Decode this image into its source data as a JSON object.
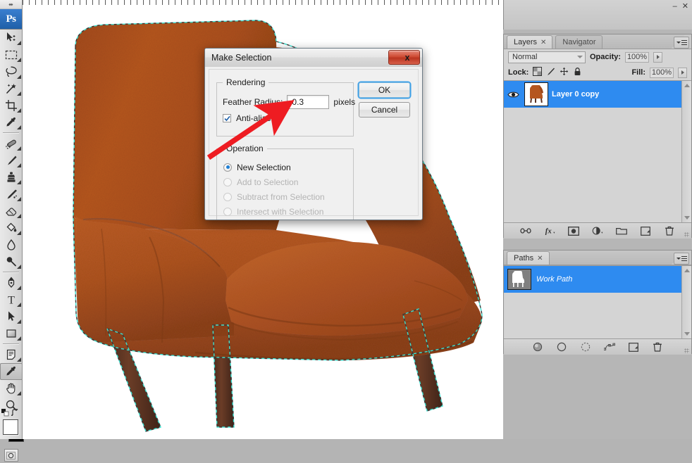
{
  "app": {
    "name": "Adobe Photoshop",
    "logo_text": "Ps"
  },
  "toolbar": {
    "grip_label": "⬌",
    "tools": [
      {
        "name": "move-tool",
        "title": "Move Tool"
      },
      {
        "name": "rectangular-marquee-tool",
        "title": "Rectangular Marquee Tool"
      },
      {
        "name": "lasso-tool",
        "title": "Lasso Tool"
      },
      {
        "name": "magic-wand-tool",
        "title": "Quick Selection / Magic Wand Tool"
      },
      {
        "name": "crop-tool",
        "title": "Crop Tool"
      },
      {
        "name": "eyedropper-tool",
        "title": "Eyedropper Tool"
      },
      {
        "name": "healing-brush-tool",
        "title": "Spot Healing Brush Tool"
      },
      {
        "name": "brush-tool",
        "title": "Brush Tool"
      },
      {
        "name": "clone-stamp-tool",
        "title": "Clone Stamp Tool"
      },
      {
        "name": "history-brush-tool",
        "title": "History Brush Tool"
      },
      {
        "name": "eraser-tool",
        "title": "Eraser Tool"
      },
      {
        "name": "paint-bucket-tool",
        "title": "Gradient / Paint Bucket Tool"
      },
      {
        "name": "blur-tool",
        "title": "Blur Tool"
      },
      {
        "name": "dodge-tool",
        "title": "Dodge Tool"
      },
      {
        "name": "pen-tool",
        "title": "Pen Tool"
      },
      {
        "name": "type-tool",
        "title": "Horizontal Type Tool"
      },
      {
        "name": "path-selection-tool",
        "title": "Path Selection Tool"
      },
      {
        "name": "rectangle-shape-tool",
        "title": "Rectangle Tool"
      },
      {
        "name": "notes-tool",
        "title": "Notes Tool"
      },
      {
        "name": "color-sampler-tool",
        "title": "Eyedropper Tool"
      },
      {
        "name": "hand-tool",
        "title": "Hand Tool"
      },
      {
        "name": "zoom-tool",
        "title": "Zoom Tool"
      }
    ],
    "foreground_color": "#ffffff",
    "background_color": "#000000",
    "quick_mask_label": "Edit in Quick Mask Mode"
  },
  "dialog": {
    "title": "Make Selection",
    "close_label": "x",
    "rendering": {
      "legend": "Rendering",
      "feather_label": "Feather Radius:",
      "feather_value": "0.3",
      "feather_units": "pixels",
      "antialiased_label": "Anti-aliased",
      "antialiased_checked": true
    },
    "operation": {
      "legend": "Operation",
      "options": [
        {
          "label": "New Selection",
          "selected": true,
          "disabled": false
        },
        {
          "label": "Add to Selection",
          "selected": false,
          "disabled": true
        },
        {
          "label": "Subtract from Selection",
          "selected": false,
          "disabled": true
        },
        {
          "label": "Intersect with Selection",
          "selected": false,
          "disabled": true
        }
      ]
    },
    "buttons": {
      "ok": "OK",
      "cancel": "Cancel"
    },
    "annotation": {
      "type": "red-arrow",
      "color": "#ee1c22",
      "points_to": "feather-radius-input"
    }
  },
  "dock": {
    "window_minimize": "–",
    "window_close": "✕"
  },
  "layers_panel": {
    "tabs": [
      {
        "label": "Layers",
        "active": true,
        "closable": true
      },
      {
        "label": "Navigator",
        "active": false,
        "closable": false
      }
    ],
    "blend_mode": "Normal",
    "opacity_label": "Opacity:",
    "opacity_value": "100%",
    "lock_label": "Lock:",
    "lock_icons": [
      "lock-transparent-pixels-icon",
      "lock-image-pixels-icon",
      "lock-position-icon",
      "lock-all-icon"
    ],
    "fill_label": "Fill:",
    "fill_value": "100%",
    "layers": [
      {
        "name": "Layer 0 copy",
        "visible": true,
        "selected": true
      }
    ],
    "footer_buttons": [
      {
        "name": "link-layers-button",
        "label": "Link layers"
      },
      {
        "name": "layer-style-button",
        "label": "fx"
      },
      {
        "name": "layer-mask-button",
        "label": "Add layer mask"
      },
      {
        "name": "adjustment-layer-button",
        "label": "Create new fill or adjustment layer"
      },
      {
        "name": "new-group-button",
        "label": "Create a new group"
      },
      {
        "name": "new-layer-button",
        "label": "Create a new layer"
      },
      {
        "name": "delete-layer-button",
        "label": "Delete layer"
      }
    ]
  },
  "paths_panel": {
    "tabs": [
      {
        "label": "Paths",
        "active": true,
        "closable": true
      }
    ],
    "paths": [
      {
        "name": "Work Path",
        "selected": true
      }
    ],
    "footer_buttons": [
      {
        "name": "fill-path-button",
        "label": "Fill path with foreground color"
      },
      {
        "name": "stroke-path-button",
        "label": "Stroke path with brush"
      },
      {
        "name": "load-path-as-selection-button",
        "label": "Load path as a selection"
      },
      {
        "name": "make-work-path-button",
        "label": "Make work path from selection"
      },
      {
        "name": "new-path-button",
        "label": "Create new path"
      },
      {
        "name": "delete-path-button",
        "label": "Delete current path"
      }
    ]
  },
  "canvas": {
    "document_label": "armchair image with active path selection",
    "background_color": "#ffffff",
    "selection_active": true,
    "artwork": {
      "subject": "mid-century orange fabric armchair",
      "fabric_color": "#b4551f",
      "leg_color": "#5b3222"
    }
  }
}
